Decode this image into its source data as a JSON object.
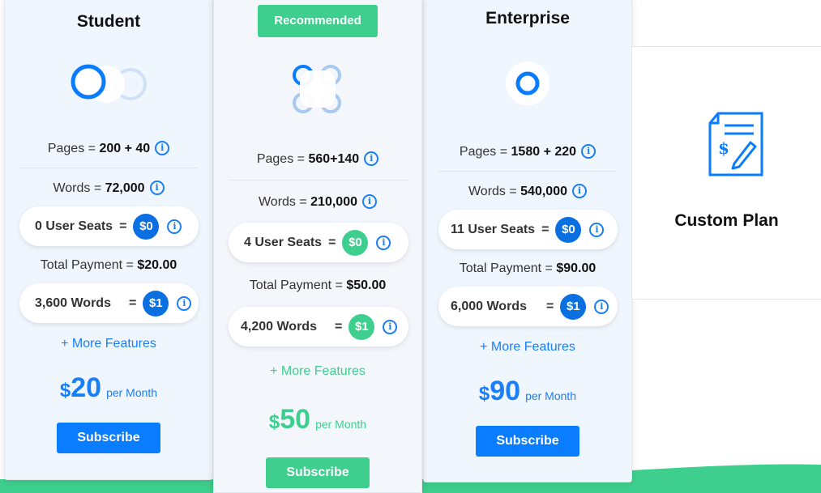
{
  "colors": {
    "accent_blue": "#0a7cff",
    "accent_green": "#3ecf8e"
  },
  "plans": {
    "student": {
      "title": "Student",
      "pages_label": "Pages = ",
      "pages_value": "200 + 40",
      "words_label": "Words = ",
      "words_value": "72,000",
      "seats_label": "0 User Seats",
      "seats_eq": "=",
      "seats_price": "$0",
      "total_label": "Total Payment = ",
      "total_value": "$20.00",
      "words_addon_label": "3,600 Words",
      "words_addon_eq": "=",
      "words_addon_price": "$1",
      "more": "+ More Features",
      "currency": "$",
      "price": "20",
      "per": "per Month",
      "subscribe": "Subscribe"
    },
    "recommended": {
      "badge": "Recommended",
      "pages_label": "Pages = ",
      "pages_value": "560+140",
      "words_label": "Words = ",
      "words_value": "210,000",
      "seats_label": "4 User Seats",
      "seats_eq": "=",
      "seats_price": "$0",
      "total_label": "Total Payment = ",
      "total_value": "$50.00",
      "words_addon_label": "4,200 Words",
      "words_addon_eq": "=",
      "words_addon_price": "$1",
      "more": "+ More Features",
      "currency": "$",
      "price": "50",
      "per": "per Month",
      "subscribe": "Subscribe"
    },
    "enterprise": {
      "title": "Enterprise",
      "pages_label": "Pages = ",
      "pages_value": "1580 + 220",
      "words_label": "Words = ",
      "words_value": "540,000",
      "seats_label": "11 User Seats",
      "seats_eq": "=",
      "seats_price": "$0",
      "total_label": "Total Payment = ",
      "total_value": "$90.00",
      "words_addon_label": "6,000 Words",
      "words_addon_eq": "=",
      "words_addon_price": "$1",
      "more": "+ More Features",
      "currency": "$",
      "price": "90",
      "per": "per Month",
      "subscribe": "Subscribe"
    },
    "custom": {
      "title": "Custom Plan",
      "icon": "document-pen-dollar-icon"
    }
  },
  "icons": {
    "info": "info-icon",
    "plan_student": "two-circles-icon",
    "plan_recommended": "four-circles-icon",
    "plan_enterprise": "single-circle-icon"
  }
}
